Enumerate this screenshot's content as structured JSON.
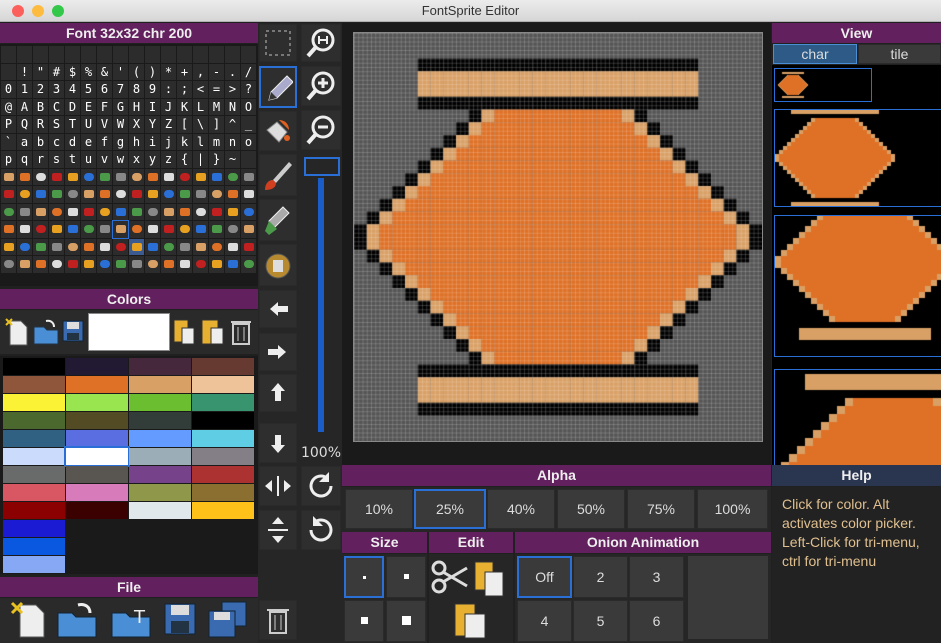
{
  "window": {
    "title": "FontSprite Editor"
  },
  "font_panel": {
    "header": "Font 32x32  chr 200"
  },
  "font_rows": [
    "",
    " ! \" # $ % & ' ( ) * + , - . /",
    "0 1 2 3 4 5 6 7 8 9 : ; < = > ?",
    "@ A B C D E F G H I J K L M N O",
    "P Q R S T U V W X Y Z [ \\ ] ^ _",
    "` a b c d e f g h i j k l m n o",
    "p q r s t u v w x y z { | } ~"
  ],
  "colors_panel": {
    "header": "Colors"
  },
  "palette": [
    "#000000",
    "#221a33",
    "#45283c",
    "#663931",
    "#8f563b",
    "#df7126",
    "#d9a066",
    "#eec39a",
    "#fbf236",
    "#99e550",
    "#6abe30",
    "#37946e",
    "#4b692f",
    "#524b24",
    "#323c39",
    "#000000",
    "#306082",
    "#5b6ee1",
    "#639bff",
    "#5fcde4",
    "#cbdbfc",
    "#ffffff",
    "#9badb7",
    "#847e87",
    "#696a6a",
    "#595652",
    "#76428a",
    "#ac3232",
    "#d95763",
    "#d77bba",
    "#8f974a",
    "#8a6f30",
    "#8b0000",
    "#3b0000",
    "#e0e8ec",
    "#fdc11a",
    "#1b1bd4",
    "",
    "",
    "",
    "#0a58e0",
    "",
    "",
    "",
    "#87a8f4",
    "",
    "",
    ""
  ],
  "file_panel": {
    "header": "File"
  },
  "zoom": {
    "level": "100%"
  },
  "alpha": {
    "header": "Alpha",
    "options": [
      "10%",
      "25%",
      "40%",
      "50%",
      "75%",
      "100%"
    ],
    "selected": "25%"
  },
  "size": {
    "header": "Size"
  },
  "edit": {
    "header": "Edit"
  },
  "onion": {
    "header": "Onion Animation",
    "options": [
      "Off",
      "2",
      "3",
      "4",
      "5",
      "6"
    ],
    "selected": "Off"
  },
  "view": {
    "header": "View",
    "tabs": [
      "char",
      "tile"
    ],
    "selected": "char"
  },
  "help": {
    "header": "Help",
    "text": "Click for color. Alt activates color picker. Left-Click for tri-menu, ctrl for tri-menu"
  },
  "icons": {
    "select": "select-rect-icon",
    "pencil": "pencil-icon",
    "fill": "fill-bucket-icon",
    "brush": "brush-icon",
    "dropper": "eyedropper-icon",
    "stamp": "stamp-icon",
    "zoom_fit": "zoom-fit-icon",
    "zoom_in": "zoom-in-icon",
    "zoom_out": "zoom-out-icon"
  }
}
